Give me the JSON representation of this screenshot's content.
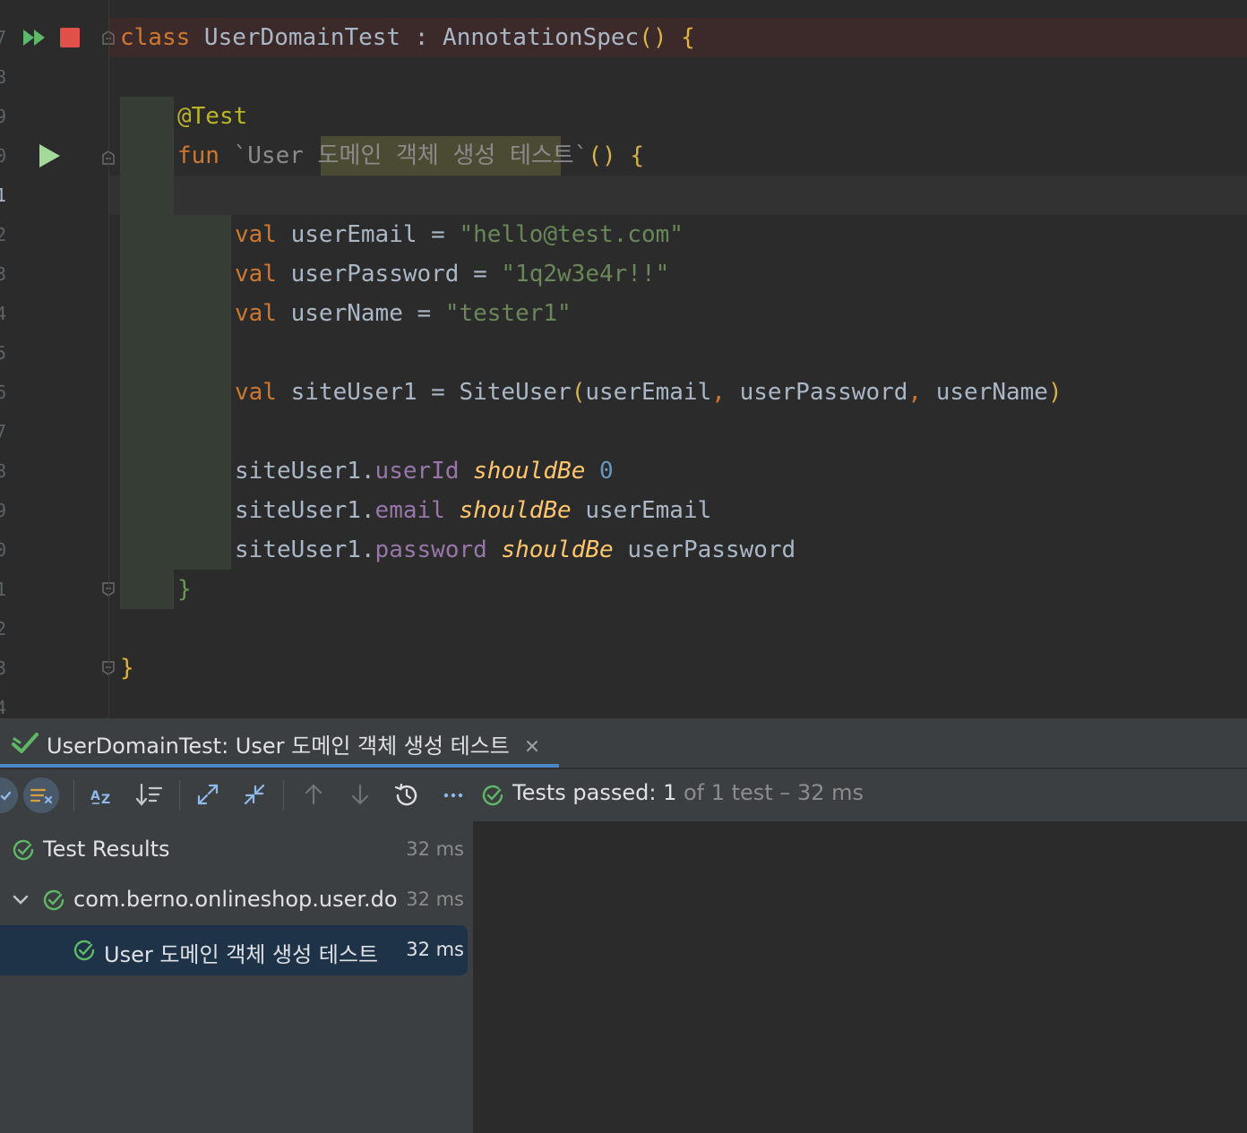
{
  "editor": {
    "line_numbers": [
      "7",
      "8",
      "9",
      "0",
      "1",
      "2",
      "3",
      "4",
      "5",
      "6",
      "7",
      "8",
      "9",
      "0",
      "1",
      "2",
      "3",
      "4"
    ],
    "lines": {
      "class_kw": "class",
      "class_name": " UserDomainTest : AnnotationSpec",
      "class_parens": "()",
      "class_brace": " {",
      "annotation": "@Test",
      "fun_kw": "fun",
      "fun_name_a": " `User ",
      "fun_name_b": "도메인 객체 생성 테스트",
      "fun_name_c": "`",
      "fun_rest": "() {",
      "val1_kw": "val",
      "val1_name": " userEmail = ",
      "val1_str": "\"hello@test.com\"",
      "val2_kw": "val",
      "val2_name": " userPassword = ",
      "val2_str": "\"1q2w3e4r!!\"",
      "val3_kw": "val",
      "val3_name": " userName = ",
      "val3_str": "\"tester1\"",
      "val4_kw": "val",
      "val4_name": " siteUser1 = SiteUser",
      "val4_open": "(",
      "val4_args_a": "userEmail",
      "val4_comma1": ", ",
      "val4_args_b": "userPassword",
      "val4_comma2": ", ",
      "val4_args_c": "userName",
      "val4_close": ")",
      "a1_obj": "siteUser1.",
      "a1_prop": "userId",
      "a1_infix": "shouldBe",
      "a1_val": "0",
      "a2_obj": "siteUser1.",
      "a2_prop": "email",
      "a2_infix": "shouldBe",
      "a2_val": "userEmail",
      "a3_obj": "siteUser1.",
      "a3_prop": "password",
      "a3_infix": "shouldBe",
      "a3_val": "userPassword",
      "fun_close": "}",
      "class_close": "}"
    }
  },
  "run_panel": {
    "tab_title": "UserDomainTest: User 도메인 객체 생성 테스트",
    "status": {
      "label": "Tests passed: ",
      "passed": "1",
      "rest": " of 1 test – 32 ms"
    },
    "tree": [
      {
        "label": "Test Results",
        "duration": "32 ms"
      },
      {
        "label": "com.berno.onlineshop.user.do",
        "duration": "32 ms"
      },
      {
        "label": "User 도메인 객체 생성 테스트",
        "duration": "32 ms"
      }
    ]
  },
  "colors": {
    "accent": "#4a88c7",
    "pass_green": "#5fb865",
    "stop_red": "#e2504a"
  }
}
